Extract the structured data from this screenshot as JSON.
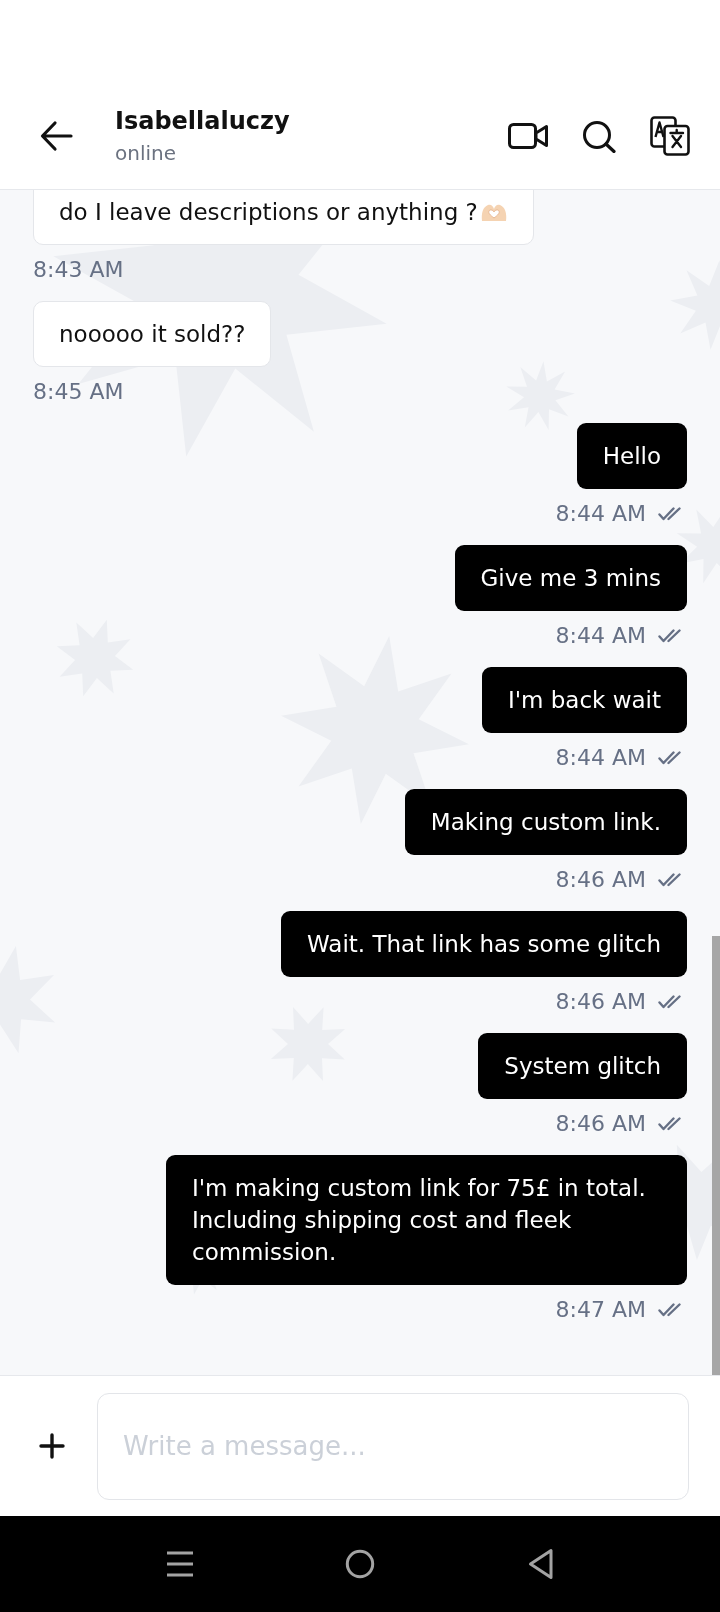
{
  "header": {
    "contact_name": "Isabellaluczy",
    "status": "online"
  },
  "messages": [
    {
      "kind": "received",
      "text": "do I leave descriptions or anything ?",
      "ends_with_emoji": true,
      "time": "8:43 AM"
    },
    {
      "kind": "received",
      "text": "nooooo it sold??",
      "ends_with_emoji": false,
      "time": "8:45 AM"
    },
    {
      "kind": "sent",
      "text": "Hello",
      "ends_with_emoji": false,
      "time": "8:44 AM",
      "delivered": true
    },
    {
      "kind": "sent",
      "text": "Give me 3 mins",
      "ends_with_emoji": false,
      "time": "8:44 AM",
      "delivered": true
    },
    {
      "kind": "sent",
      "text": "I'm back wait",
      "ends_with_emoji": false,
      "time": "8:44 AM",
      "delivered": true
    },
    {
      "kind": "sent",
      "text": "Making custom link.",
      "ends_with_emoji": false,
      "time": "8:46 AM",
      "delivered": true
    },
    {
      "kind": "sent",
      "text": "Wait. That link has some glitch",
      "ends_with_emoji": false,
      "time": "8:46 AM",
      "delivered": true
    },
    {
      "kind": "sent",
      "text": "System glitch",
      "ends_with_emoji": false,
      "time": "8:46 AM",
      "delivered": true
    },
    {
      "kind": "sent",
      "text": "I'm making custom link for 75£ in total. Including shipping cost and fleek commission.",
      "ends_with_emoji": false,
      "time": "8:47 AM",
      "delivered": true
    }
  ],
  "composer": {
    "placeholder": "Write a message..."
  }
}
